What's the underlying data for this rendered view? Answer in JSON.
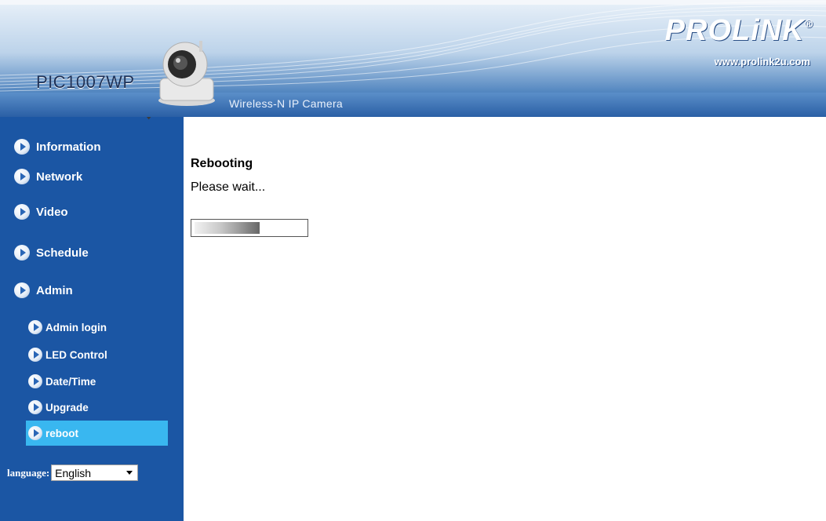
{
  "header": {
    "model": "PIC1007WP",
    "tagline": "Wireless-N IP Camera",
    "brand": "PROLiNK",
    "brand_mark": "®",
    "url": "www.prolink2u.com"
  },
  "sidebar": {
    "main_items": [
      {
        "label": "Information"
      },
      {
        "label": "Network"
      },
      {
        "label": "Video"
      },
      {
        "label": "Schedule"
      },
      {
        "label": "Admin"
      }
    ],
    "admin_items": [
      {
        "label": "Admin login"
      },
      {
        "label": "LED Control"
      },
      {
        "label": "Date/Time"
      },
      {
        "label": "Upgrade"
      },
      {
        "label": "reboot",
        "active": true
      }
    ],
    "language_label": "language:",
    "language_value": "English"
  },
  "main": {
    "title": "Rebooting",
    "message": "Please wait...",
    "progress_fraction": 0.59
  },
  "colors": {
    "sidebar_bg": "#1b56a4",
    "active_item_bg": "#39b7f0"
  }
}
